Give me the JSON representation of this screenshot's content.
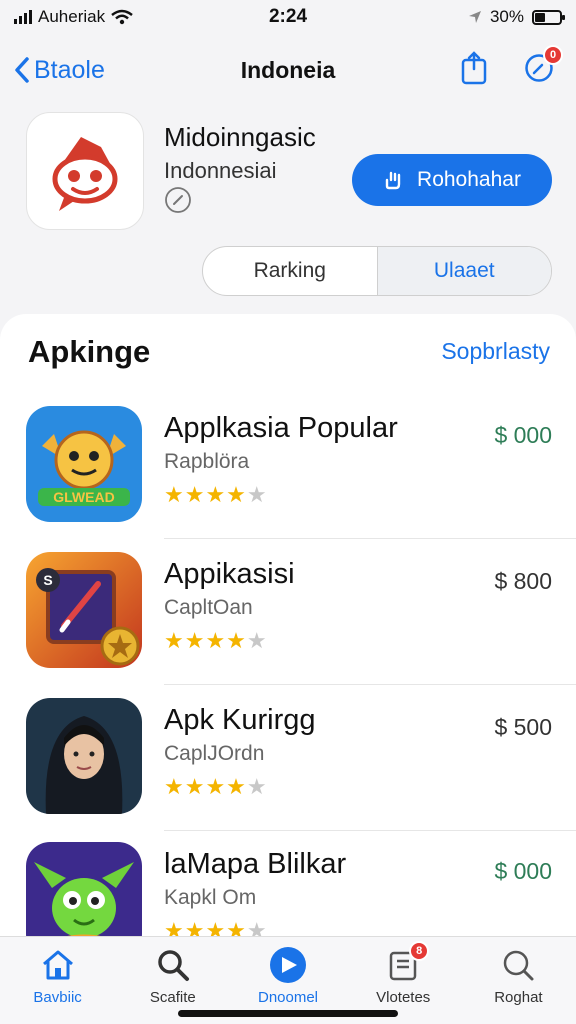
{
  "status": {
    "carrier": "Auheriak",
    "time": "2:24",
    "battery": "30%"
  },
  "nav": {
    "back_label": "Btaole",
    "title": "Indoneia",
    "notif_count": "0"
  },
  "app": {
    "name": "Midoinngasic",
    "subtitle": "Indonnesiai",
    "get_label": "Rohohahar"
  },
  "segment": {
    "tab1": "Rarking",
    "tab2": "Ulaaet"
  },
  "section": {
    "title": "Apkinge",
    "link": "Sopbrlasty"
  },
  "apps": [
    {
      "name": "Applkasia Popular",
      "sub": "Rapblöra",
      "price": "$ 000",
      "rating": 4,
      "price_color": "green"
    },
    {
      "name": "Appikasisi",
      "sub": "CapltOan",
      "price": "$ 800",
      "rating": 4,
      "price_color": "gray"
    },
    {
      "name": "Apk Kurirgg",
      "sub": "CaplJOrdn",
      "price": "$ 500",
      "rating": 4,
      "price_color": "gray"
    },
    {
      "name": "laMapa Blilkar",
      "sub": "Kapkl Om",
      "price": "$ 000",
      "rating": 4,
      "price_color": "green"
    }
  ],
  "tabs": [
    {
      "label": "Bavbiic",
      "icon": "home-icon"
    },
    {
      "label": "Scafite",
      "icon": "search-icon"
    },
    {
      "label": "Dnoomel",
      "icon": "play-icon"
    },
    {
      "label": "Vlotetes",
      "icon": "updates-icon",
      "badge": "8"
    },
    {
      "label": "Roghat",
      "icon": "search-icon"
    }
  ],
  "colors": {
    "accent": "#1a73e8",
    "star": "#f4b400",
    "price_green": "#2e7d57"
  }
}
